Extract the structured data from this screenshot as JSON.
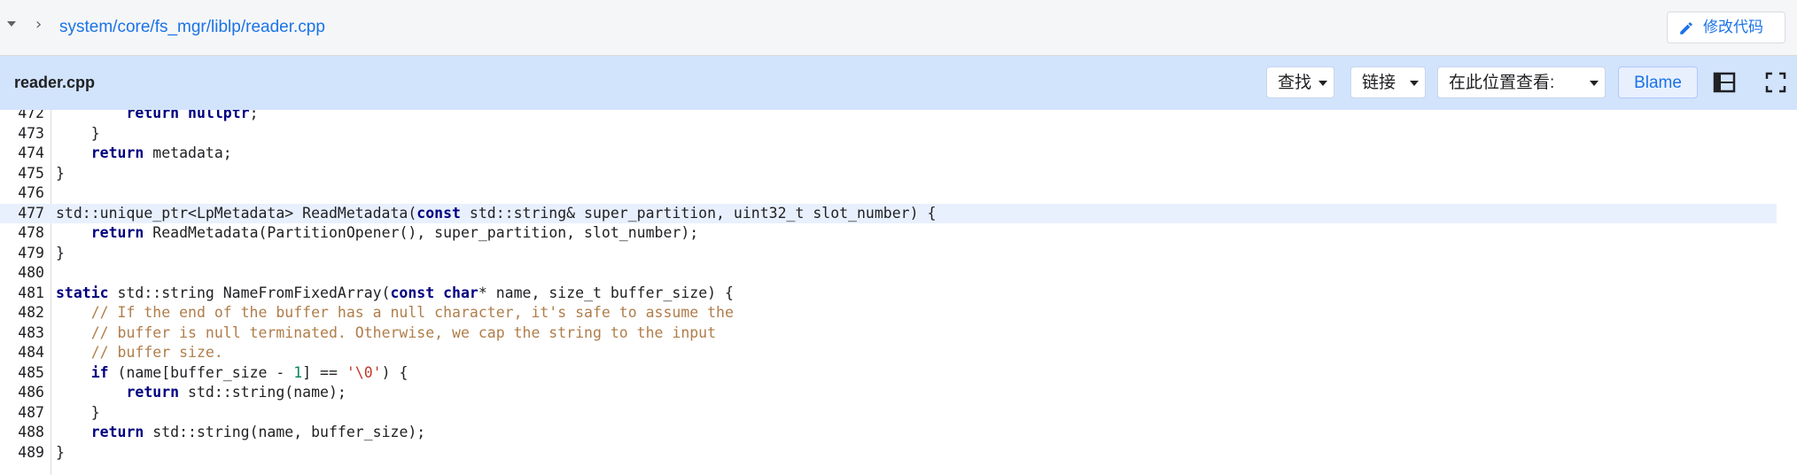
{
  "breadcrumb": {
    "path": "system/core/fs_mgr/liblp/reader.cpp",
    "edit_label": "修改代码"
  },
  "file_header": {
    "filename": "reader.cpp",
    "find_label": "查找",
    "link_label": "链接",
    "view_at_label": "在此位置查看:",
    "blame_label": "Blame"
  },
  "icons": {
    "expand_caret": "caret-down-icon",
    "path_chevron": "chevron-right-icon",
    "edit": "pencil-icon",
    "layout": "panel-layout-icon",
    "fullscreen": "fullscreen-icon"
  },
  "colors": {
    "link": "#1a73e8",
    "header_bg": "#d2e3fc",
    "highlight": "#e8f0fe",
    "keyword": "#000080",
    "comment": "#b07d4a"
  },
  "highlighted_line": "477",
  "code": [
    {
      "n": "472",
      "tokens": [
        {
          "t": "        "
        },
        {
          "t": "return",
          "c": "kw"
        },
        {
          "t": " "
        },
        {
          "t": "nullptr",
          "c": "kw"
        },
        {
          "t": ";"
        }
      ]
    },
    {
      "n": "473",
      "tokens": [
        {
          "t": "    }"
        }
      ]
    },
    {
      "n": "474",
      "tokens": [
        {
          "t": "    "
        },
        {
          "t": "return",
          "c": "kw"
        },
        {
          "t": " metadata;"
        }
      ]
    },
    {
      "n": "475",
      "tokens": [
        {
          "t": "}"
        }
      ]
    },
    {
      "n": "476",
      "tokens": []
    },
    {
      "n": "477",
      "tokens": [
        {
          "t": "std::unique_ptr<LpMetadata> ReadMetadata("
        },
        {
          "t": "const",
          "c": "kw"
        },
        {
          "t": " std::string& super_partition, uint32_t slot_number) {"
        }
      ]
    },
    {
      "n": "478",
      "tokens": [
        {
          "t": "    "
        },
        {
          "t": "return",
          "c": "kw"
        },
        {
          "t": " ReadMetadata(PartitionOpener(), super_partition, slot_number);"
        }
      ]
    },
    {
      "n": "479",
      "tokens": [
        {
          "t": "}"
        }
      ]
    },
    {
      "n": "480",
      "tokens": []
    },
    {
      "n": "481",
      "tokens": [
        {
          "t": "static",
          "c": "kw"
        },
        {
          "t": " std::string NameFromFixedArray("
        },
        {
          "t": "const",
          "c": "kw"
        },
        {
          "t": " "
        },
        {
          "t": "char",
          "c": "kw"
        },
        {
          "t": "* name, size_t buffer_size) {"
        }
      ]
    },
    {
      "n": "482",
      "tokens": [
        {
          "t": "    "
        },
        {
          "t": "// If the end of the buffer has a null character, it's safe to assume the",
          "c": "cm"
        }
      ]
    },
    {
      "n": "483",
      "tokens": [
        {
          "t": "    "
        },
        {
          "t": "// buffer is null terminated. Otherwise, we cap the string to the input",
          "c": "cm"
        }
      ]
    },
    {
      "n": "484",
      "tokens": [
        {
          "t": "    "
        },
        {
          "t": "// buffer size.",
          "c": "cm"
        }
      ]
    },
    {
      "n": "485",
      "tokens": [
        {
          "t": "    "
        },
        {
          "t": "if",
          "c": "kw"
        },
        {
          "t": " (name[buffer_size - "
        },
        {
          "t": "1",
          "c": "num"
        },
        {
          "t": "] == "
        },
        {
          "t": "'\\0'",
          "c": "str"
        },
        {
          "t": ") {"
        }
      ]
    },
    {
      "n": "486",
      "tokens": [
        {
          "t": "        "
        },
        {
          "t": "return",
          "c": "kw"
        },
        {
          "t": " std::string(name);"
        }
      ]
    },
    {
      "n": "487",
      "tokens": [
        {
          "t": "    }"
        }
      ]
    },
    {
      "n": "488",
      "tokens": [
        {
          "t": "    "
        },
        {
          "t": "return",
          "c": "kw"
        },
        {
          "t": " std::string(name, buffer_size);"
        }
      ]
    },
    {
      "n": "489",
      "tokens": [
        {
          "t": "}"
        }
      ]
    }
  ]
}
